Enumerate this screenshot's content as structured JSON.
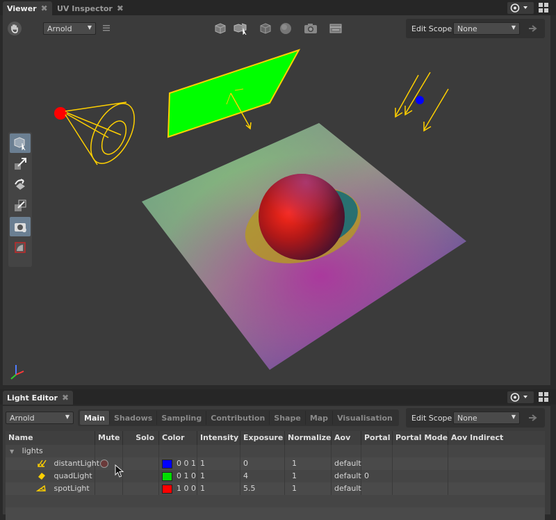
{
  "viewer": {
    "tabs": [
      {
        "label": "Viewer",
        "close": "✖"
      },
      {
        "label": "UV Inspector",
        "close": "✖"
      }
    ],
    "renderer": "Arnold",
    "edit_scope_label": "Edit Scope",
    "edit_scope_value": "None",
    "colors": {
      "quad": "#00ff00",
      "outline": "#ffd000",
      "spot_dot": "#ff0000",
      "distant_dot": "#0000ff"
    }
  },
  "light_editor": {
    "title": "Light Editor",
    "close": "✖",
    "renderer": "Arnold",
    "tabs": [
      "Main",
      "Shadows",
      "Sampling",
      "Contribution",
      "Shape",
      "Map",
      "Visualisation"
    ],
    "active_tab": "Main",
    "edit_scope_label": "Edit Scope",
    "edit_scope_value": "None",
    "columns": [
      "Name",
      "Mute",
      "Solo",
      "Color",
      "Intensity",
      "Exposure",
      "Normalize",
      "Aov",
      "Portal",
      "Portal Mode",
      "Aov Indirect"
    ],
    "group": "lights",
    "rows": [
      {
        "name": "distantLight",
        "icon": "distant-light-icon",
        "color": "0 0 1",
        "swatch": "#0000ff",
        "intensity": "1",
        "exposure": "0",
        "normalize": "1",
        "aov": "default",
        "portal": ""
      },
      {
        "name": "quadLight",
        "icon": "quad-light-icon",
        "color": "0 1 0",
        "swatch": "#00ff00",
        "intensity": "1",
        "exposure": "4",
        "normalize": "1",
        "aov": "default",
        "portal": "0"
      },
      {
        "name": "spotLight",
        "icon": "spot-light-icon",
        "color": "1 0 0",
        "swatch": "#ff0000",
        "intensity": "1",
        "exposure": "5.5",
        "normalize": "1",
        "aov": "default",
        "portal": ""
      }
    ]
  }
}
